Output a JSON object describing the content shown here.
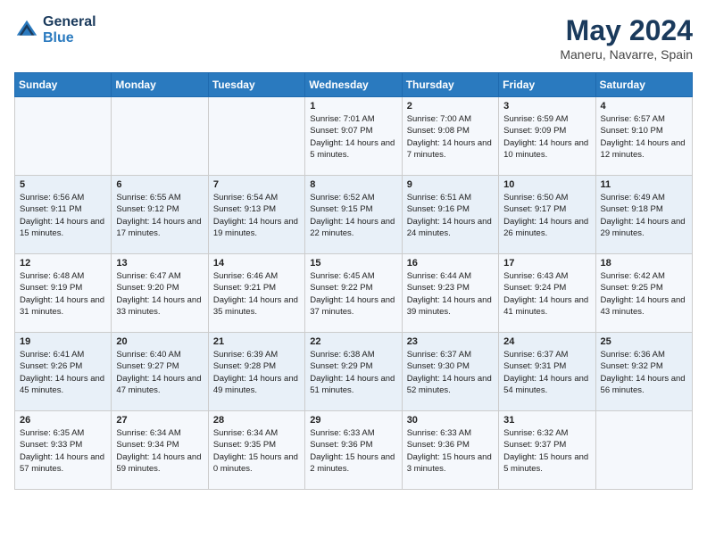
{
  "header": {
    "logo_line1": "General",
    "logo_line2": "Blue",
    "month_title": "May 2024",
    "location": "Maneru, Navarre, Spain"
  },
  "days_of_week": [
    "Sunday",
    "Monday",
    "Tuesday",
    "Wednesday",
    "Thursday",
    "Friday",
    "Saturday"
  ],
  "weeks": [
    [
      {
        "day": "",
        "sunrise": "",
        "sunset": "",
        "daylight": ""
      },
      {
        "day": "",
        "sunrise": "",
        "sunset": "",
        "daylight": ""
      },
      {
        "day": "",
        "sunrise": "",
        "sunset": "",
        "daylight": ""
      },
      {
        "day": "1",
        "sunrise": "Sunrise: 7:01 AM",
        "sunset": "Sunset: 9:07 PM",
        "daylight": "Daylight: 14 hours and 5 minutes."
      },
      {
        "day": "2",
        "sunrise": "Sunrise: 7:00 AM",
        "sunset": "Sunset: 9:08 PM",
        "daylight": "Daylight: 14 hours and 7 minutes."
      },
      {
        "day": "3",
        "sunrise": "Sunrise: 6:59 AM",
        "sunset": "Sunset: 9:09 PM",
        "daylight": "Daylight: 14 hours and 10 minutes."
      },
      {
        "day": "4",
        "sunrise": "Sunrise: 6:57 AM",
        "sunset": "Sunset: 9:10 PM",
        "daylight": "Daylight: 14 hours and 12 minutes."
      }
    ],
    [
      {
        "day": "5",
        "sunrise": "Sunrise: 6:56 AM",
        "sunset": "Sunset: 9:11 PM",
        "daylight": "Daylight: 14 hours and 15 minutes."
      },
      {
        "day": "6",
        "sunrise": "Sunrise: 6:55 AM",
        "sunset": "Sunset: 9:12 PM",
        "daylight": "Daylight: 14 hours and 17 minutes."
      },
      {
        "day": "7",
        "sunrise": "Sunrise: 6:54 AM",
        "sunset": "Sunset: 9:13 PM",
        "daylight": "Daylight: 14 hours and 19 minutes."
      },
      {
        "day": "8",
        "sunrise": "Sunrise: 6:52 AM",
        "sunset": "Sunset: 9:15 PM",
        "daylight": "Daylight: 14 hours and 22 minutes."
      },
      {
        "day": "9",
        "sunrise": "Sunrise: 6:51 AM",
        "sunset": "Sunset: 9:16 PM",
        "daylight": "Daylight: 14 hours and 24 minutes."
      },
      {
        "day": "10",
        "sunrise": "Sunrise: 6:50 AM",
        "sunset": "Sunset: 9:17 PM",
        "daylight": "Daylight: 14 hours and 26 minutes."
      },
      {
        "day": "11",
        "sunrise": "Sunrise: 6:49 AM",
        "sunset": "Sunset: 9:18 PM",
        "daylight": "Daylight: 14 hours and 29 minutes."
      }
    ],
    [
      {
        "day": "12",
        "sunrise": "Sunrise: 6:48 AM",
        "sunset": "Sunset: 9:19 PM",
        "daylight": "Daylight: 14 hours and 31 minutes."
      },
      {
        "day": "13",
        "sunrise": "Sunrise: 6:47 AM",
        "sunset": "Sunset: 9:20 PM",
        "daylight": "Daylight: 14 hours and 33 minutes."
      },
      {
        "day": "14",
        "sunrise": "Sunrise: 6:46 AM",
        "sunset": "Sunset: 9:21 PM",
        "daylight": "Daylight: 14 hours and 35 minutes."
      },
      {
        "day": "15",
        "sunrise": "Sunrise: 6:45 AM",
        "sunset": "Sunset: 9:22 PM",
        "daylight": "Daylight: 14 hours and 37 minutes."
      },
      {
        "day": "16",
        "sunrise": "Sunrise: 6:44 AM",
        "sunset": "Sunset: 9:23 PM",
        "daylight": "Daylight: 14 hours and 39 minutes."
      },
      {
        "day": "17",
        "sunrise": "Sunrise: 6:43 AM",
        "sunset": "Sunset: 9:24 PM",
        "daylight": "Daylight: 14 hours and 41 minutes."
      },
      {
        "day": "18",
        "sunrise": "Sunrise: 6:42 AM",
        "sunset": "Sunset: 9:25 PM",
        "daylight": "Daylight: 14 hours and 43 minutes."
      }
    ],
    [
      {
        "day": "19",
        "sunrise": "Sunrise: 6:41 AM",
        "sunset": "Sunset: 9:26 PM",
        "daylight": "Daylight: 14 hours and 45 minutes."
      },
      {
        "day": "20",
        "sunrise": "Sunrise: 6:40 AM",
        "sunset": "Sunset: 9:27 PM",
        "daylight": "Daylight: 14 hours and 47 minutes."
      },
      {
        "day": "21",
        "sunrise": "Sunrise: 6:39 AM",
        "sunset": "Sunset: 9:28 PM",
        "daylight": "Daylight: 14 hours and 49 minutes."
      },
      {
        "day": "22",
        "sunrise": "Sunrise: 6:38 AM",
        "sunset": "Sunset: 9:29 PM",
        "daylight": "Daylight: 14 hours and 51 minutes."
      },
      {
        "day": "23",
        "sunrise": "Sunrise: 6:37 AM",
        "sunset": "Sunset: 9:30 PM",
        "daylight": "Daylight: 14 hours and 52 minutes."
      },
      {
        "day": "24",
        "sunrise": "Sunrise: 6:37 AM",
        "sunset": "Sunset: 9:31 PM",
        "daylight": "Daylight: 14 hours and 54 minutes."
      },
      {
        "day": "25",
        "sunrise": "Sunrise: 6:36 AM",
        "sunset": "Sunset: 9:32 PM",
        "daylight": "Daylight: 14 hours and 56 minutes."
      }
    ],
    [
      {
        "day": "26",
        "sunrise": "Sunrise: 6:35 AM",
        "sunset": "Sunset: 9:33 PM",
        "daylight": "Daylight: 14 hours and 57 minutes."
      },
      {
        "day": "27",
        "sunrise": "Sunrise: 6:34 AM",
        "sunset": "Sunset: 9:34 PM",
        "daylight": "Daylight: 14 hours and 59 minutes."
      },
      {
        "day": "28",
        "sunrise": "Sunrise: 6:34 AM",
        "sunset": "Sunset: 9:35 PM",
        "daylight": "Daylight: 15 hours and 0 minutes."
      },
      {
        "day": "29",
        "sunrise": "Sunrise: 6:33 AM",
        "sunset": "Sunset: 9:36 PM",
        "daylight": "Daylight: 15 hours and 2 minutes."
      },
      {
        "day": "30",
        "sunrise": "Sunrise: 6:33 AM",
        "sunset": "Sunset: 9:36 PM",
        "daylight": "Daylight: 15 hours and 3 minutes."
      },
      {
        "day": "31",
        "sunrise": "Sunrise: 6:32 AM",
        "sunset": "Sunset: 9:37 PM",
        "daylight": "Daylight: 15 hours and 5 minutes."
      },
      {
        "day": "",
        "sunrise": "",
        "sunset": "",
        "daylight": ""
      }
    ]
  ]
}
